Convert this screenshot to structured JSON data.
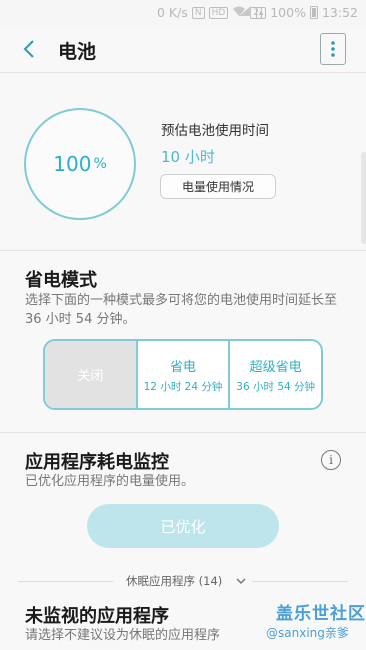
{
  "status_bar": {
    "speed": "0 K/s",
    "hd_badge": "HD",
    "sim_badge": "2",
    "battery": "100%",
    "time": "13:52"
  },
  "header": {
    "title": "电池"
  },
  "battery_gauge": {
    "percent": "100",
    "unit": "%",
    "estimate_label": "预估电池使用时间",
    "estimate_value": "10 小时",
    "usage_button": "电量使用情况"
  },
  "power_saving": {
    "title": "省电模式",
    "description": "选择下面的一种模式最多可将您的电池使用时间延长至 36 小时 54 分钟。",
    "modes": [
      {
        "name": "关闭",
        "time": ""
      },
      {
        "name": "省电",
        "time": "12 小时 24 分钟"
      },
      {
        "name": "超级省电",
        "time": "36 小时 54 分钟"
      }
    ]
  },
  "app_monitor": {
    "title": "应用程序耗电监控",
    "description": "已优化应用程序的电量使用。",
    "optimize_button": "已优化",
    "dormant_label": "休眠应用程序 (14)"
  },
  "unmonitored": {
    "title": "未监视的应用程序",
    "description": "请选择不建议设为休眠的应用程序"
  },
  "watermark": {
    "line1": "盖乐世社区",
    "line2": "@sanxing亲爹"
  },
  "colors": {
    "accent": "#32aec4",
    "ring": "#7fcbd8",
    "button_disabled": "#bfe5ec"
  }
}
